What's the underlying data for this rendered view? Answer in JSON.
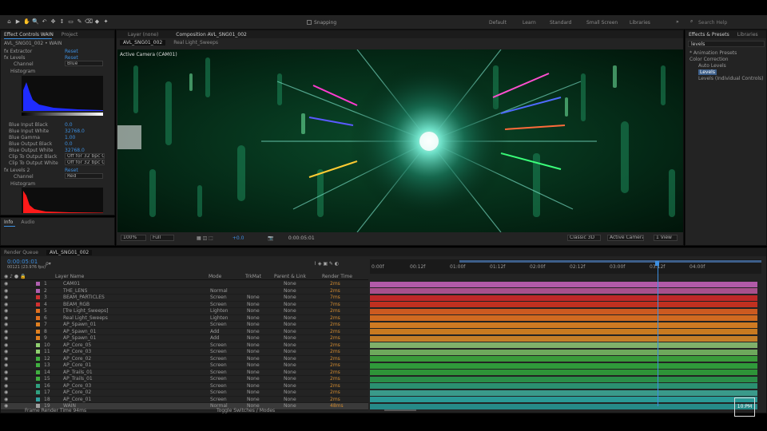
{
  "toolbar": {
    "tools": [
      "⌂",
      "▶",
      "✋",
      "🔍",
      "↶",
      "✥",
      "↕",
      "▭",
      "✎",
      "⌫",
      "◆",
      "✦"
    ],
    "snapping": "Snapping",
    "workspaces": [
      "Default",
      "Learn",
      "Standard",
      "Small Screen",
      "Libraries"
    ],
    "search_placeholder": "Search Help",
    "accent": "#3d8fe0"
  },
  "effect_controls": {
    "tabs": [
      "Effect Controls WAIN",
      "Project"
    ],
    "comp": "AVL_SNG01_002 • WAIN",
    "rows": [
      {
        "label": "fx  Extractor",
        "value": "Reset"
      },
      {
        "label": "fx  Levels",
        "value": "Reset"
      },
      {
        "label": "Channel",
        "value": "Blue"
      },
      {
        "label": "Histogram",
        "value": ""
      },
      {
        "label": "Blue Input Black",
        "value": "0.0"
      },
      {
        "label": "Blue Input White",
        "value": "32768.0"
      },
      {
        "label": "Blue Gamma",
        "value": "1.00"
      },
      {
        "label": "Blue Output Black",
        "value": "0.0"
      },
      {
        "label": "Blue Output White",
        "value": "32768.0"
      },
      {
        "label": "Clip To Output Black",
        "value": "Off for 32 bpc Co"
      },
      {
        "label": "Clip To Output White",
        "value": "Off for 32 bpc Co"
      },
      {
        "label": "fx  Levels 2",
        "value": "Reset"
      },
      {
        "label": "Channel",
        "value": "Red"
      },
      {
        "label": "Histogram",
        "value": ""
      }
    ],
    "bottom_tabs": [
      "Info",
      "Audio"
    ]
  },
  "comp_viewer": {
    "tabs": [
      "Layer (none)",
      "Composition AVL_SNG01_002"
    ],
    "subtabs": [
      "AVL_SNG01_002",
      "Real Light_Sweeps"
    ],
    "camera_label": "Active Camera (CAM01)",
    "zoom": "100%",
    "resolution": "Full",
    "timecode": "0:00:05:01",
    "exposure": "+0.0",
    "renderer": "Classic 3D",
    "camera": "Active Camera",
    "views": "1 View"
  },
  "effects_presets": {
    "tabs": [
      "Effects & Presets",
      "Libraries"
    ],
    "search": "levels",
    "tree": [
      "* Animation Presets",
      "Color Correction",
      "Auto Levels",
      "Levels",
      "Levels (Individual Controls)"
    ]
  },
  "timeline": {
    "tabs": [
      "Render Queue",
      "AVL_SNG01_002"
    ],
    "timecode": "0:00:05:01",
    "frames": "00121 (23.976 fps)",
    "search_placeholder": "ρ▾",
    "ruler": [
      "0:00f",
      "00:12f",
      "01:00f",
      "01:12f",
      "02:00f",
      "02:12f",
      "03:00f",
      "03:12f",
      "04:00f"
    ],
    "col_headers": {
      "name": "Layer Name",
      "mode": "Mode",
      "trk": "TrkMat",
      "parent": "Parent & Link",
      "render": "Render Time"
    },
    "footer": "Frame Render Time 94ms",
    "toggle": "Toggle Switches / Modes",
    "layers": [
      {
        "n": "1",
        "name": "CAM01",
        "color": "#b060b0",
        "mode": "",
        "trk": "",
        "parent": "None",
        "render": "2ms",
        "barcolor": "#b25aa8"
      },
      {
        "n": "2",
        "name": "THE_LENS",
        "color": "#b060b0",
        "mode": "Normal",
        "trk": "",
        "parent": "None",
        "render": "2ms",
        "barcolor": "#a8508c"
      },
      {
        "n": "3",
        "name": "BEAM_PARTICLES",
        "color": "#d03030",
        "mode": "Screen",
        "trk": "None",
        "parent": "None",
        "render": "7ms",
        "barcolor": "#c02828"
      },
      {
        "n": "4",
        "name": "BEAM_RGB",
        "color": "#d03030",
        "mode": "Screen",
        "trk": "None",
        "parent": "None",
        "render": "7ms",
        "barcolor": "#c03020"
      },
      {
        "n": "5",
        "name": "[Tre Light_Sweeps]",
        "color": "#e07020",
        "mode": "Lighten",
        "trk": "None",
        "parent": "None",
        "render": "2ms",
        "barcolor": "#cc5a20"
      },
      {
        "n": "6",
        "name": "Real Light_Sweeps",
        "color": "#e07020",
        "mode": "Lighten",
        "trk": "None",
        "parent": "None",
        "render": "2ms",
        "barcolor": "#d06a20"
      },
      {
        "n": "7",
        "name": "AP_Spawn_01",
        "color": "#e08020",
        "mode": "Screen",
        "trk": "None",
        "parent": "None",
        "render": "2ms",
        "barcolor": "#cf7a22"
      },
      {
        "n": "8",
        "name": "AP_Spawn_01",
        "color": "#e08020",
        "mode": "Add",
        "trk": "None",
        "parent": "None",
        "render": "2ms",
        "barcolor": "#c87a20"
      },
      {
        "n": "9",
        "name": "AP_Spawn_01",
        "color": "#e08020",
        "mode": "Add",
        "trk": "None",
        "parent": "None",
        "render": "2ms",
        "barcolor": "#c47e28"
      },
      {
        "n": "10",
        "name": "AP_Core_05",
        "color": "#90d070",
        "mode": "Screen",
        "trk": "None",
        "parent": "None",
        "render": "2ms",
        "barcolor": "#7fb06a"
      },
      {
        "n": "11",
        "name": "AP_Core_03",
        "color": "#90d070",
        "mode": "Screen",
        "trk": "None",
        "parent": "None",
        "render": "2ms",
        "barcolor": "#6ea85c"
      },
      {
        "n": "12",
        "name": "AP_Core_02",
        "color": "#40b040",
        "mode": "Screen",
        "trk": "None",
        "parent": "None",
        "render": "2ms",
        "barcolor": "#3a9a3a"
      },
      {
        "n": "13",
        "name": "AP_Core_01",
        "color": "#40b040",
        "mode": "Screen",
        "trk": "None",
        "parent": "None",
        "render": "2ms",
        "barcolor": "#2f9a3a"
      },
      {
        "n": "14",
        "name": "AP_Trails_01",
        "color": "#40b040",
        "mode": "Screen",
        "trk": "None",
        "parent": "None",
        "render": "2ms",
        "barcolor": "#2e9438"
      },
      {
        "n": "15",
        "name": "AP_Trails_01",
        "color": "#40b040",
        "mode": "Screen",
        "trk": "None",
        "parent": "None",
        "render": "2ms",
        "barcolor": "#2a8e48"
      },
      {
        "n": "16",
        "name": "AP_Core_03",
        "color": "#30a080",
        "mode": "Screen",
        "trk": "None",
        "parent": "None",
        "render": "2ms",
        "barcolor": "#2a9070"
      },
      {
        "n": "17",
        "name": "AP_Core_02",
        "color": "#30a080",
        "mode": "Screen",
        "trk": "None",
        "parent": "None",
        "render": "2ms",
        "barcolor": "#3a9a8a"
      },
      {
        "n": "18",
        "name": "AP_Core_01",
        "color": "#30a0a0",
        "mode": "Screen",
        "trk": "None",
        "parent": "None",
        "render": "2ms",
        "barcolor": "#2a9a96"
      },
      {
        "n": "19",
        "name": "WAIN",
        "color": "#a0a0a0",
        "mode": "Normal",
        "trk": "None",
        "parent": "None",
        "render": "48ms",
        "barcolor": "#268a88"
      }
    ]
  },
  "clock": "10:PM"
}
